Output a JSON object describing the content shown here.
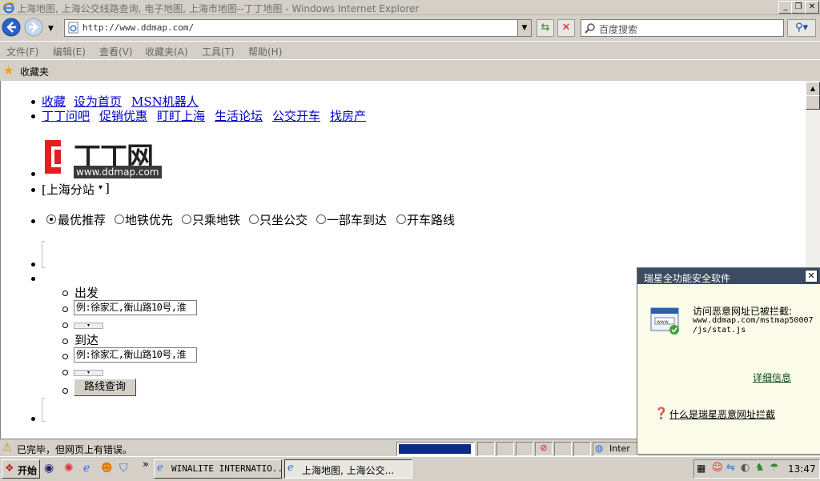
{
  "window": {
    "title": "上海地图, 上海公交线路查询, 电子地图, 上海市地图--丁丁地图 - Windows Internet Explorer",
    "minimize": "_",
    "restore": "❐",
    "close": "✕"
  },
  "addressbar": {
    "url": "http://www.ddmap.com/",
    "search_placeholder": "百度搜索"
  },
  "menu": [
    "文件(F)",
    "编辑(E)",
    "查看(V)",
    "收藏夹(A)",
    "工具(T)",
    "帮助(H)"
  ],
  "favorites": {
    "label": "收藏夹"
  },
  "page": {
    "toplinks": [
      "收藏",
      "设为首页",
      "MSN机器人"
    ],
    "navlinks": [
      "丁丁问吧",
      "促销优惠",
      "盯盯上海",
      "生活论坛",
      "公交开车",
      "找房产"
    ],
    "logo_text": "丁丁网",
    "logo_url": "www.ddmap.com",
    "city": "[上海分站",
    "city_arrow": "▾",
    "city_end": "]",
    "route_options": [
      "最优推荐",
      "地铁优先",
      "只乘地铁",
      "只坐公交",
      "一部车到达",
      "开车路线"
    ],
    "selected_option": 0,
    "from_label": "出发",
    "from_value": "例:徐家汇,衡山路10号,淮",
    "to_label": "到达",
    "to_value": "例:徐家汇,衡山路10号,淮",
    "search_button": "路线查询"
  },
  "status": {
    "text": "已完毕，但网页上有错误。",
    "zone": "Inter"
  },
  "taskbar": {
    "start": "开始",
    "more": "»",
    "tasks": [
      "WINALITE INTERNATIO...",
      "上海地图, 上海公交..."
    ],
    "clock": "13:47"
  },
  "popup": {
    "title": "瑞星全功能安全软件",
    "message": "访问恶意网址已被拦截:",
    "url_line1": "www.ddmap.com/mstmap50007",
    "url_line2": "/js/stat.js",
    "details_link": "详细信息",
    "help_link": "什么是瑞星恶意网址拦截"
  }
}
